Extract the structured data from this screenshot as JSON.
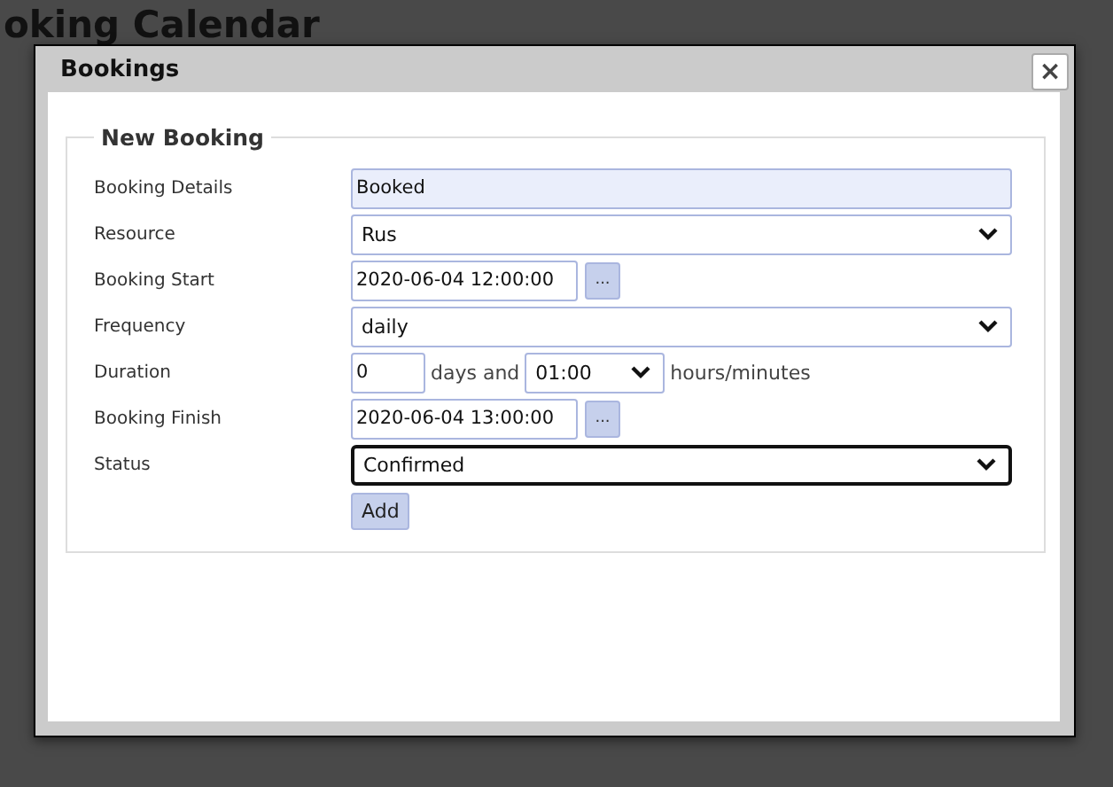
{
  "page": {
    "title": "oking Calendar"
  },
  "dialog": {
    "title": "Bookings",
    "close": "×",
    "section": "New Booking",
    "fields": [
      {
        "label": "Booking Details",
        "kind": "text",
        "value": "Booked"
      },
      {
        "label": "Resource",
        "kind": "select",
        "value": "Rus",
        "focused": false
      },
      {
        "label": "Booking Start",
        "kind": "date",
        "value": "2020-06-04 12:00:00",
        "button": "..."
      },
      {
        "label": "Frequency",
        "kind": "select",
        "value": "daily",
        "focused": false
      },
      {
        "label": "Duration",
        "kind": "duration",
        "days": "0",
        "joiner": "days and",
        "time": "01:00",
        "unit": "hours/minutes"
      },
      {
        "label": "Booking Finish",
        "kind": "date",
        "value": "2020-06-04 13:00:00",
        "button": "..."
      },
      {
        "label": "Status",
        "kind": "select",
        "value": "Confirmed",
        "focused": true
      }
    ],
    "submit": "Add"
  }
}
